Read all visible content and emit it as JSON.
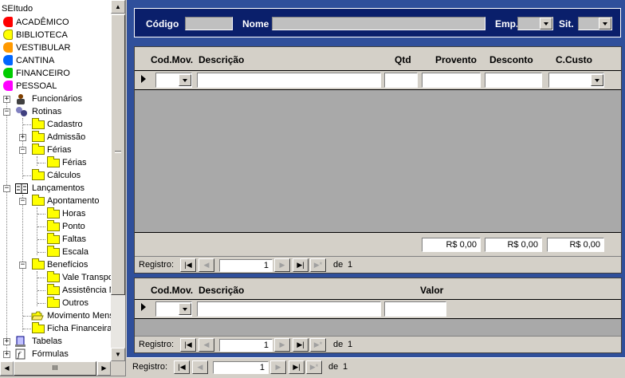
{
  "tree": {
    "root": "SEItudo",
    "modules": [
      {
        "label": "ACADÊMICO",
        "color": "#ff0000"
      },
      {
        "label": "BIBLIOTECA",
        "color": "#ffff00"
      },
      {
        "label": "VESTIBULAR",
        "color": "#ff9900"
      },
      {
        "label": "CANTINA",
        "color": "#0066ff"
      },
      {
        "label": "FINANCEIRO",
        "color": "#00cc00"
      },
      {
        "label": "PESSOAL",
        "color": "#ff00ff"
      }
    ],
    "nodes": {
      "funcionarios": "Funcionários",
      "rotinas": "Rotinas",
      "cadastro": "Cadastro",
      "admissao": "Admissão",
      "ferias": "Férias",
      "ferias_child": "Férias",
      "calculos": "Cálculos",
      "lancamentos": "Lançamentos",
      "apontamento": "Apontamento",
      "horas": "Horas",
      "ponto": "Ponto",
      "faltas": "Faltas",
      "escala": "Escala",
      "beneficios": "Benefícios",
      "vale_transporte": "Vale Transpo",
      "assistencia": "Assistência M",
      "outros": "Outros",
      "movimento_mensal": "Movimento Mens",
      "ficha_financeira": "Ficha Financeira",
      "tabelas": "Tabelas",
      "formulas": "Fórmulas"
    },
    "hscroll_grip": "III"
  },
  "header": {
    "codigo_label": "Código",
    "nome_label": "Nome",
    "emp_label": "Emp.",
    "sit_label": "Sit."
  },
  "grid1": {
    "columns": {
      "codmov": "Cod.Mov.",
      "descricao": "Descrição",
      "qtd": "Qtd",
      "provento": "Provento",
      "desconto": "Desconto",
      "ccusto": "C.Custo"
    },
    "totals": {
      "provento": "R$ 0,00",
      "desconto": "R$ 0,00",
      "ccusto": "R$ 0,00"
    }
  },
  "grid2": {
    "columns": {
      "codmov": "Cod.Mov.",
      "descricao": "Descrição",
      "valor": "Valor"
    }
  },
  "nav1": {
    "label": "Registro:",
    "current": "1",
    "of": "de",
    "total": "1"
  },
  "nav2": {
    "label": "Registro:",
    "current": "1",
    "of": "de",
    "total": "1"
  },
  "nav3": {
    "label": "Registro:",
    "current": "1",
    "of": "de",
    "total": "1"
  },
  "nav_icons": {
    "first": "first-record-icon",
    "prev": "prev-record-icon",
    "next": "next-record-icon",
    "last": "last-record-icon",
    "new": "new-record-icon"
  }
}
